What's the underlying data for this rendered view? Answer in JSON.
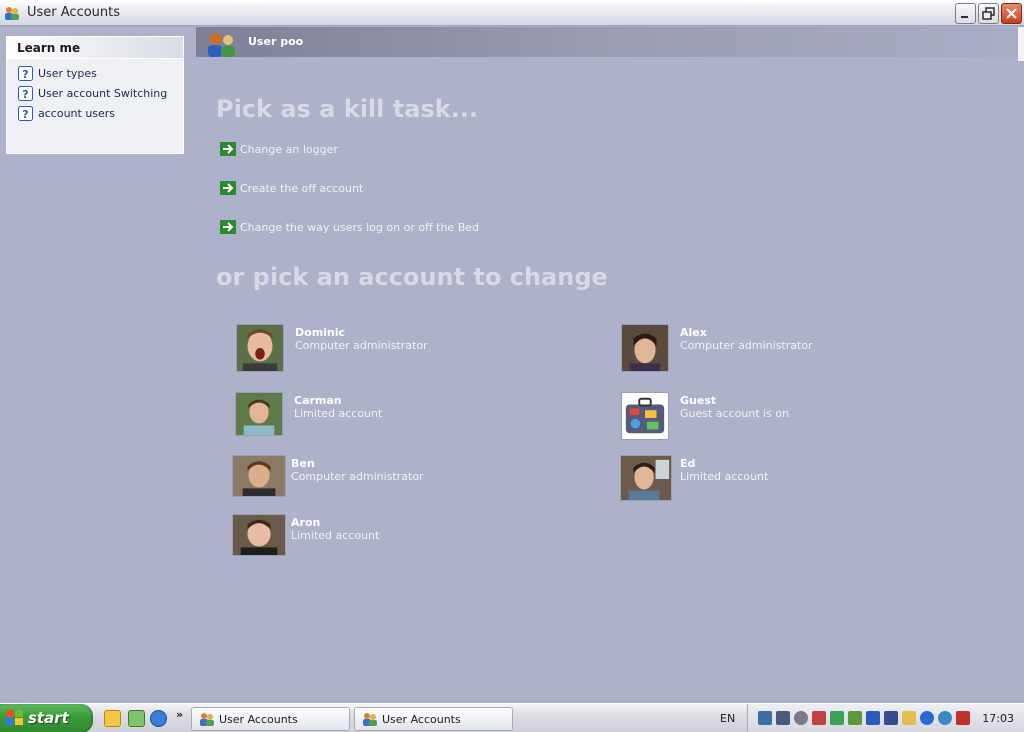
{
  "window": {
    "title": "User Accounts"
  },
  "sidebar": {
    "heading": "Learn me",
    "items": [
      {
        "label": "User types"
      },
      {
        "label": "User account Switching"
      },
      {
        "label": "account users"
      }
    ]
  },
  "header": {
    "user_name": "User poo"
  },
  "tasks": {
    "heading": "Pick as a kill  task...",
    "items": [
      {
        "label": "Change an logger"
      },
      {
        "label": "Create the off account"
      },
      {
        "label": "Change the way users log on or off the Bed"
      }
    ]
  },
  "accounts": {
    "heading": "or pick an account to change",
    "items": [
      {
        "name": "Dominic",
        "type": "Computer administrator"
      },
      {
        "name": "Alex",
        "type": "Computer administrator"
      },
      {
        "name": "Carman",
        "type": "Limited account"
      },
      {
        "name": "Guest",
        "type": "Guest account is on"
      },
      {
        "name": "Ben",
        "type": "Computer administrator"
      },
      {
        "name": "Ed",
        "type": "Limited account"
      },
      {
        "name": "Aron",
        "type": "Limited account"
      }
    ]
  },
  "taskbar": {
    "start_label": "start",
    "more_label": "»",
    "buttons": [
      {
        "label": "User Accounts"
      },
      {
        "label": "User Accounts"
      }
    ],
    "language": "EN",
    "clock": "17:03"
  },
  "colors": {
    "background": "#adb1c9",
    "heading_text": "#d7d9e6",
    "start_green": "#3a9b3a",
    "close_red": "#c5401e"
  }
}
